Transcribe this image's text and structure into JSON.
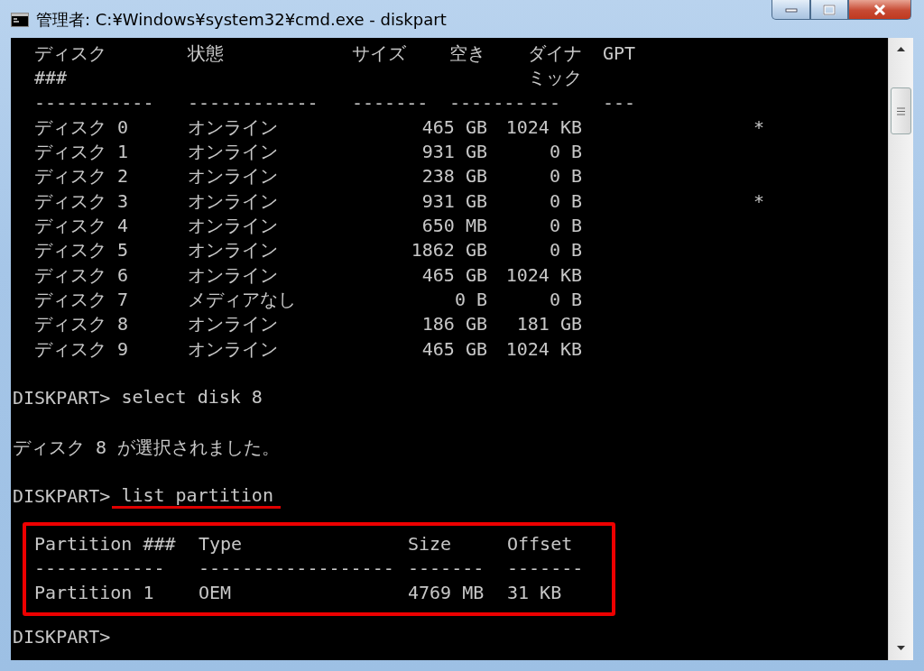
{
  "window": {
    "title": "管理者: C:¥Windows¥system32¥cmd.exe - diskpart"
  },
  "disk_table": {
    "columns": [
      {
        "lines": [
          "ディスク",
          "###"
        ]
      },
      {
        "lines": [
          "状態"
        ]
      },
      {
        "lines": [
          "サイズ"
        ]
      },
      {
        "lines": [
          "空き"
        ]
      },
      {
        "lines": [
          "ダイナ",
          "ミック"
        ]
      },
      {
        "lines": [
          "GPT"
        ]
      }
    ],
    "separators": [
      "-----------",
      "------------",
      "-------",
      "-------",
      "---",
      "---"
    ],
    "rows": [
      {
        "disk": "ディスク 0",
        "status": "オンライン",
        "size": "465 GB",
        "free": "1024 KB",
        "gpt": "*"
      },
      {
        "disk": "ディスク 1",
        "status": "オンライン",
        "size": "931 GB",
        "free": "0 B"
      },
      {
        "disk": "ディスク 2",
        "status": "オンライン",
        "size": "238 GB",
        "free": "0 B"
      },
      {
        "disk": "ディスク 3",
        "status": "オンライン",
        "size": "931 GB",
        "free": "0 B",
        "gpt": "*"
      },
      {
        "disk": "ディスク 4",
        "status": "オンライン",
        "size": "650 MB",
        "free": "0 B"
      },
      {
        "disk": "ディスク 5",
        "status": "オンライン",
        "size": "1862 GB",
        "free": "0 B"
      },
      {
        "disk": "ディスク 6",
        "status": "オンライン",
        "size": "465 GB",
        "free": "1024 KB"
      },
      {
        "disk": "ディスク 7",
        "status": "メディアなし",
        "size": "0 B",
        "free": "0 B"
      },
      {
        "disk": "ディスク 8",
        "status": "オンライン",
        "size": "186 GB",
        "free": "181 GB"
      },
      {
        "disk": "ディスク 9",
        "status": "オンライン",
        "size": "465 GB",
        "free": "1024 KB"
      }
    ]
  },
  "console_lines": [
    {
      "kind": "blank"
    },
    {
      "kind": "prompt",
      "prompt": "DISKPART>",
      "command": "select disk 8",
      "underlined": false
    },
    {
      "kind": "blank"
    },
    {
      "kind": "output",
      "text": "ディスク 8 が選択されました。"
    },
    {
      "kind": "blank"
    },
    {
      "kind": "prompt",
      "prompt": "DISKPART>",
      "command": "list partition",
      "underlined": true
    }
  ],
  "partition_table": {
    "highlighted": true,
    "columns": [
      "Partition ###",
      "Type",
      "Size",
      "Offset"
    ],
    "separators": [
      "------------",
      "------------------",
      "-------",
      "-------"
    ],
    "rows": [
      [
        "Partition 1",
        "OEM",
        "4769 MB",
        "31 KB"
      ]
    ]
  },
  "final_prompt": "DISKPART>"
}
